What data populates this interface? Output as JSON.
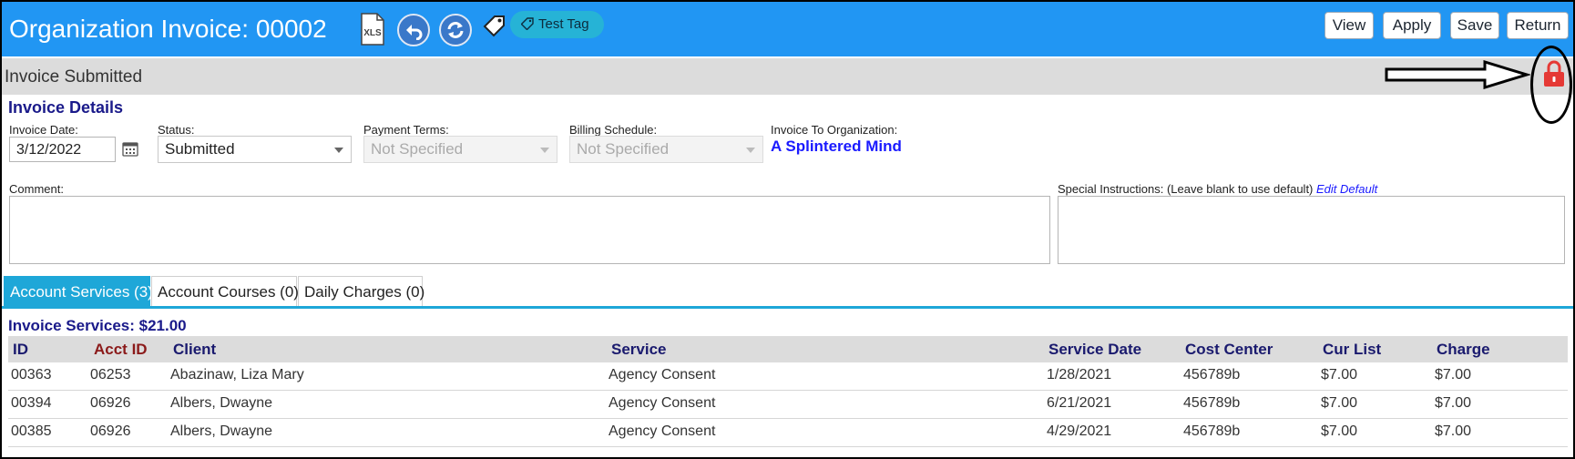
{
  "header": {
    "title": "Organization Invoice: 00002",
    "xls_label": "XLS",
    "test_tag_label": "Test Tag",
    "buttons": {
      "view": "View",
      "apply": "Apply",
      "save": "Save",
      "return": "Return"
    },
    "bg_color": "#2196f3"
  },
  "status_bar": {
    "text": "Invoice Submitted",
    "lock_color": "#e53935"
  },
  "details": {
    "section_title": "Invoice Details",
    "invoice_date": {
      "label": "Invoice Date:",
      "value": "3/12/2022"
    },
    "status": {
      "label": "Status:",
      "value": "Submitted"
    },
    "payment_terms": {
      "label": "Payment Terms:",
      "value": "Not Specified"
    },
    "billing_schedule": {
      "label": "Billing Schedule:",
      "value": "Not Specified"
    },
    "invoice_to": {
      "label": "Invoice To Organization:",
      "value": "A Splintered Mind"
    },
    "comment_label": "Comment:",
    "special_label": "Special Instructions: (Leave blank to use default)",
    "edit_default": "Edit Default"
  },
  "tabs": [
    {
      "label": "Account Services (3)",
      "active": true
    },
    {
      "label": "Account Courses (0)",
      "active": false
    },
    {
      "label": "Daily Charges (0)",
      "active": false
    }
  ],
  "services": {
    "title": "Invoice Services: $21.00",
    "columns": [
      "ID",
      "Acct ID",
      "Client",
      "Service",
      "Service Date",
      "Cost Center",
      "Cur List",
      "Charge"
    ],
    "rows": [
      [
        "00363",
        "06253",
        "Abazinaw, Liza Mary",
        "Agency Consent",
        "1/28/2021",
        "456789b",
        "$7.00",
        "$7.00"
      ],
      [
        "00394",
        "06926",
        "Albers, Dwayne",
        "Agency Consent",
        "6/21/2021",
        "456789b",
        "$7.00",
        "$7.00"
      ],
      [
        "00385",
        "06926",
        "Albers, Dwayne",
        "Agency Consent",
        "4/29/2021",
        "456789b",
        "$7.00",
        "$7.00"
      ]
    ]
  }
}
